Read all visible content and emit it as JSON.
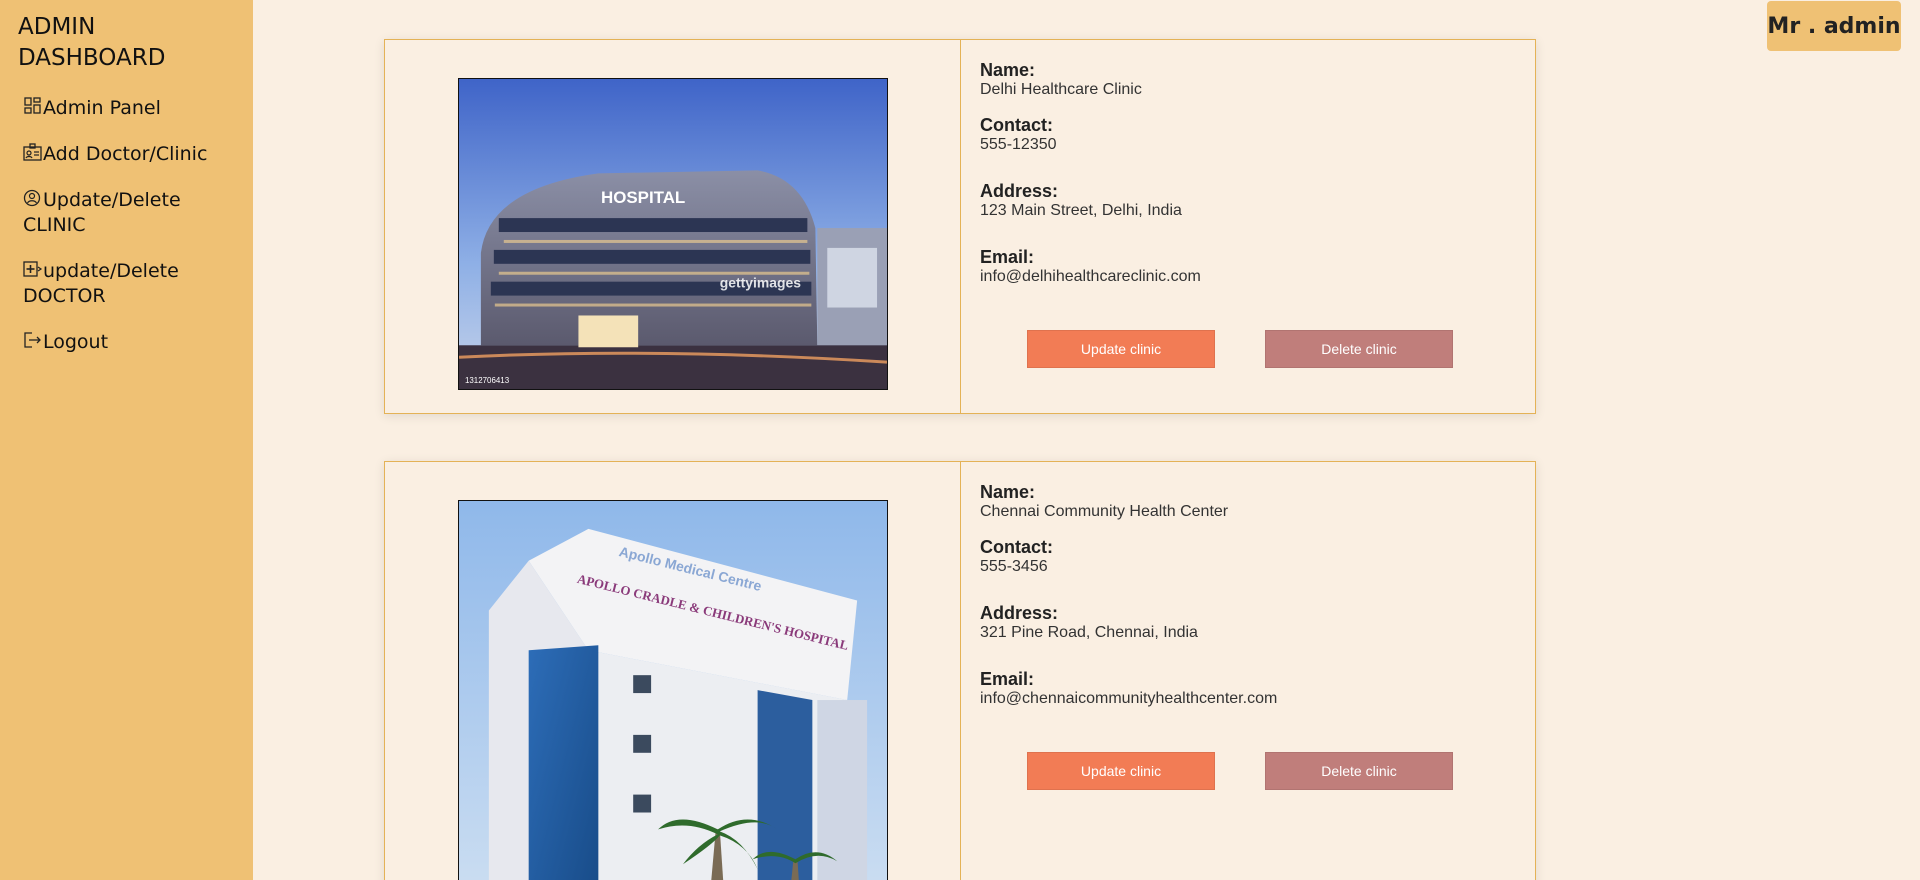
{
  "sidebar": {
    "title": "ADMIN DASHBOARD",
    "items": [
      {
        "label": "Admin Panel",
        "icon": "dashboard-icon"
      },
      {
        "label": "Add Doctor/Clinic",
        "icon": "id-card-icon"
      },
      {
        "label": "Update/Delete CLINIC",
        "icon": "user-circle-icon"
      },
      {
        "label": "update/Delete DOCTOR",
        "icon": "medical-plus-icon"
      },
      {
        "label": "Logout",
        "icon": "logout-icon"
      }
    ]
  },
  "header": {
    "user": "Mr . admin"
  },
  "labels": {
    "name": "Name:",
    "contact": "Contact:",
    "address": "Address:",
    "email": "Email:",
    "update": "Update clinic",
    "delete": "Delete clinic"
  },
  "clinics": [
    {
      "name": "Delhi Healthcare Clinic",
      "contact": "555-12350",
      "address": "123 Main Street, Delhi, India",
      "email": "info@delhihealthcareclinic.com",
      "photo_sign": "HOSPITAL",
      "photo_watermark": "gettyimages",
      "photo_id": "1312706413"
    },
    {
      "name": "Chennai Community Health Center",
      "contact": "555-3456",
      "address": "321 Pine Road, Chennai, India",
      "email": "info@chennaicommunityhealthcenter.com",
      "photo_sign": "APOLLO CRADLE & CHILDREN'S HOSPITAL",
      "photo_sign_top": "Apollo Medical Centre"
    }
  ],
  "colors": {
    "sidebar": "#efc174",
    "background": "#faefe2",
    "border": "#e4b256",
    "update_button": "#f27c55",
    "delete_button": "#c07e7b"
  }
}
